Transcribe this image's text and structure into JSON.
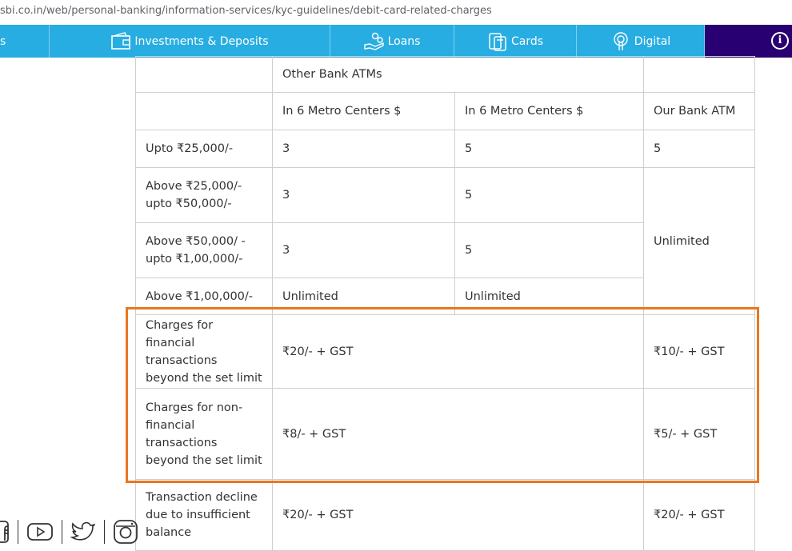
{
  "browser": {
    "url": "sbi.co.in/web/personal-banking/information-services/kyc-guidelines/debit-card-related-charges"
  },
  "nav": {
    "partial_label": "s",
    "items": [
      {
        "label": "Investments & Deposits",
        "icon": "wallet-icon"
      },
      {
        "label": "Loans",
        "icon": "loans-icon"
      },
      {
        "label": "Cards",
        "icon": "cards-icon"
      },
      {
        "label": "Digital",
        "icon": "digital-icon"
      }
    ],
    "info_icon": "i",
    "colors": {
      "nav_bg": "#27ade1",
      "nav_accent": "#280071"
    }
  },
  "table": {
    "rows": [
      [
        "",
        "Other Bank ATMs",
        "",
        ""
      ],
      [
        "",
        "In 6 Metro Centers $",
        "In 6 Metro Centers $",
        "Our Bank ATM"
      ],
      [
        "Upto ₹25,000/-",
        "3",
        "5",
        "5"
      ],
      [
        "Above ₹25,000/- upto ₹50,000/-",
        "3",
        "5",
        "Unlimited"
      ],
      [
        "Above ₹50,000/ - upto ₹1,00,000/-",
        "3",
        "5",
        ""
      ],
      [
        "Above ₹1,00,000/-",
        "Unlimited",
        "Unlimited",
        ""
      ],
      [
        "Charges for financial transactions beyond the set limit",
        "₹20/- + GST",
        "",
        "₹10/- + GST"
      ],
      [
        "Charges for non-financial transactions beyond the set limit",
        "₹8/- + GST",
        "",
        "₹5/- + GST"
      ],
      [
        "Transaction decline due to insufficient balance",
        "₹20/- + GST",
        "",
        "₹20/- + GST"
      ]
    ],
    "highlight_color": "#e87722"
  },
  "social": [
    "facebook-icon",
    "youtube-icon",
    "twitter-icon",
    "instagram-icon"
  ]
}
